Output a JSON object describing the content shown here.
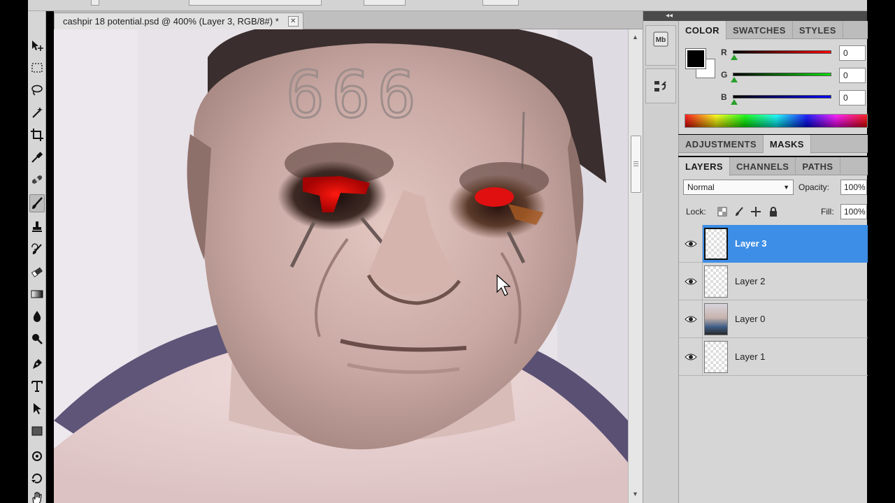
{
  "document": {
    "tab_title": "cashpir 18 potential.psd @ 400% (Layer 3, RGB/8#) *",
    "close_glyph": "✕",
    "canvas_text": "666"
  },
  "tools": [
    "move-tool",
    "marquee-tool",
    "lasso-tool",
    "magic-wand-tool",
    "crop-tool",
    "eyedropper-tool",
    "healing-brush-tool",
    "brush-tool",
    "clone-stamp-tool",
    "history-brush-tool",
    "eraser-tool",
    "gradient-tool",
    "blur-tool",
    "dodge-tool",
    "pen-tool",
    "type-tool",
    "path-selection-tool",
    "rectangle-tool",
    "3d-rotate-tool",
    "3d-orbit-tool",
    "hand-tool"
  ],
  "active_tool": "brush-tool",
  "dock": {
    "collapse_glyph": "◂◂",
    "mini_label": "Mb"
  },
  "color_panel": {
    "tabs": [
      "COLOR",
      "SWATCHES",
      "STYLES"
    ],
    "channels": [
      {
        "label": "R",
        "value": "0",
        "color": "#ff0000"
      },
      {
        "label": "G",
        "value": "0",
        "color": "#00c000"
      },
      {
        "label": "B",
        "value": "0",
        "color": "#0000ff"
      }
    ],
    "foreground": "#000000",
    "background": "#ffffff"
  },
  "adjustments_panel": {
    "tabs": [
      "ADJUSTMENTS",
      "MASKS"
    ]
  },
  "layers_panel": {
    "tabs": [
      "LAYERS",
      "CHANNELS",
      "PATHS"
    ],
    "blend_mode": "Normal",
    "opacity_label": "Opacity:",
    "opacity": "100%",
    "lock_label": "Lock:",
    "fill_label": "Fill:",
    "fill": "100%",
    "layers": [
      {
        "name": "Layer 3",
        "selected": true
      },
      {
        "name": "Layer 2",
        "selected": false
      },
      {
        "name": "Layer 0",
        "selected": false
      },
      {
        "name": "Layer 1",
        "selected": false
      }
    ]
  },
  "colors": {
    "selection": "#3d8ee6",
    "panel_bg": "#d6d6d6",
    "dock_header": "#4a4a4a"
  }
}
